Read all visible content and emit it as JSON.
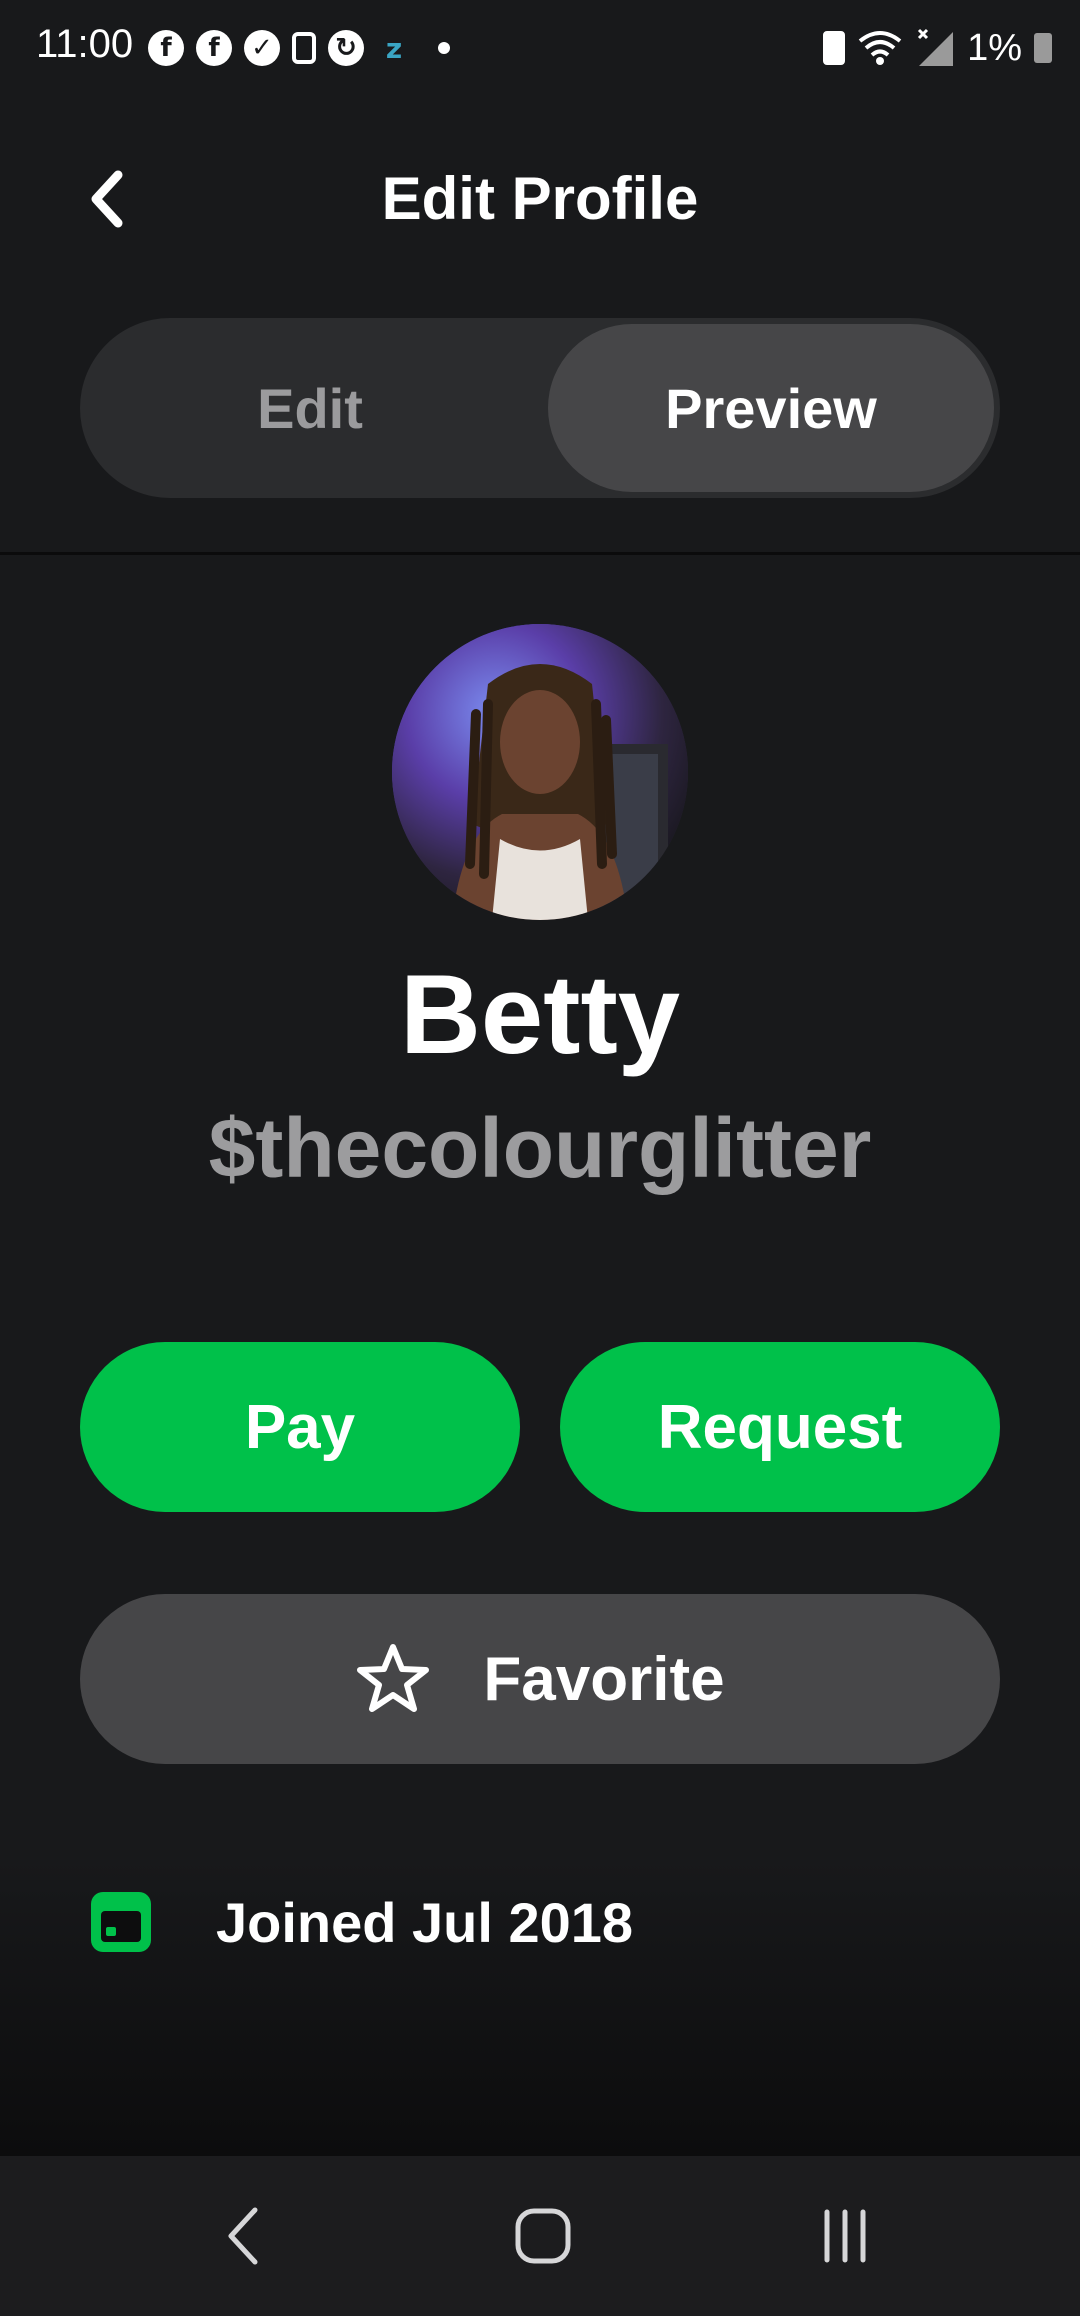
{
  "status_bar": {
    "time": "11:00",
    "battery_percent": "1%",
    "icons": [
      "facebook-icon",
      "facebook-icon",
      "check-badge-icon",
      "lock-icon",
      "sync-icon",
      "z-icon",
      "dot-icon",
      "battery-saver-icon",
      "wifi-icon",
      "signal-icon",
      "battery-charging-icon"
    ]
  },
  "header": {
    "title": "Edit Profile",
    "back_icon": "chevron-left-icon"
  },
  "segmented_control": {
    "edit_label": "Edit",
    "preview_label": "Preview",
    "selected": "Preview"
  },
  "profile": {
    "name": "Betty",
    "cashtag": "$thecolourglitter"
  },
  "actions": {
    "pay_label": "Pay",
    "request_label": "Request",
    "favorite_label": "Favorite",
    "favorite_icon": "star-outline-icon"
  },
  "details": {
    "joined_label": "Joined Jul 2018",
    "joined_icon": "calendar-icon"
  },
  "colors": {
    "background": "#18191b",
    "accent_green": "#00c14a",
    "segment_selected": "#464648",
    "secondary_text": "#9c9c9e"
  },
  "nav_bar": {
    "items": [
      "back-nav-icon",
      "home-nav-icon",
      "recents-nav-icon"
    ]
  }
}
